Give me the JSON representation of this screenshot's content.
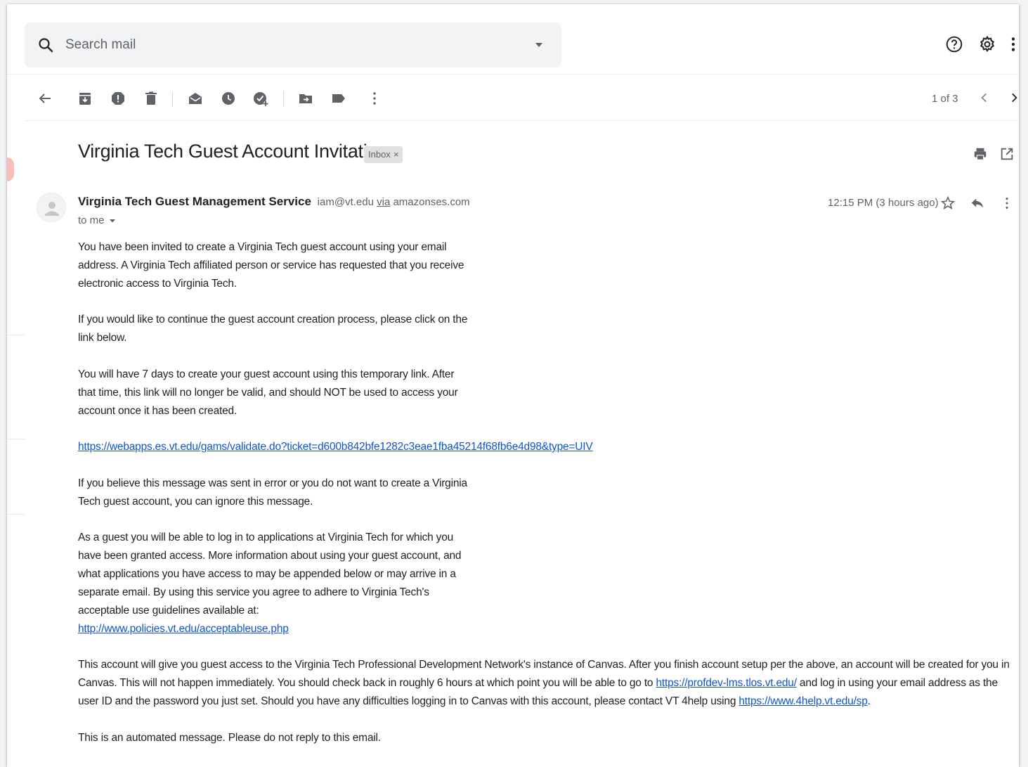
{
  "search": {
    "placeholder": "Search mail"
  },
  "toolbar": {
    "back": "arrow-back-icon",
    "archive": "archive-icon",
    "spam": "report-spam-icon",
    "delete": "delete-icon",
    "mark_unread": "mark-unread-icon",
    "snooze": "snooze-icon",
    "add_task": "add-task-icon",
    "move_to": "move-to-icon",
    "labels": "label-icon",
    "more": "more-vert-icon",
    "pager": "1 of 3"
  },
  "email": {
    "subject": "Virginia Tech Guest Account Invitation",
    "label_chip": "Inbox",
    "label_close": "×",
    "sender_name": "Virginia Tech Guest Management Service",
    "sender_email": "iam@vt.edu",
    "via": "via",
    "via_domain": "amazonses.com",
    "recipient": "to me",
    "time": "12:15 PM (3 hours ago)",
    "body": {
      "p1": "You have been invited to create a Virginia Tech guest account using your email address. A Virginia Tech affiliated person or service has requested that you receive electronic access to Virginia Tech.",
      "p2": "If you would like to continue the guest account creation process, please click on the link below.",
      "p3": "You will have 7 days to create your guest account using this temporary link. After that time, this link will no longer be valid, and should NOT be used to access your account once it has been created.",
      "validate_link": "https://webapps.es.vt.edu/gams/validate.do?ticket=d600b842bfe1282c3eae1fba45214f68fb6e4d98&type=UIV",
      "p5": "If you believe this message was sent in error or you do not want to create a Virginia Tech guest account, you can ignore this message.",
      "p6": "As a guest you will be able to log in to applications at Virginia Tech for which you have been granted access. More information about using your guest account, and what applications you have access to may be appended below or may arrive in a separate email. By using this service you agree to adhere to Virginia Tech's acceptable use guidelines available at:",
      "policy_link": "http://www.policies.vt.edu/acceptableuse.php",
      "p7_a": "This account will give you guest access to the Virginia Tech Professional Development Network's instance of Canvas. After you finish account setup per the above, an account will be created for you in Canvas. This will not happen immediately. You should check back in roughly 6 hours at which point you will be able to go to ",
      "canvas_link": "https://profdev-lms.tlos.vt.edu/",
      "p7_b": " and log in using your email address as the user ID and the password you just set. Should you have any difficulties logging in to Canvas with this account, please contact VT 4help using ",
      "help_link": "https://www.4help.vt.edu/sp",
      "p7_c": ".",
      "p8": "This is an automated message. Please do not reply to this email."
    }
  },
  "colors": {
    "link": "#1155cc",
    "icon": "#5f6368",
    "search_bg": "#f1f3f4"
  }
}
